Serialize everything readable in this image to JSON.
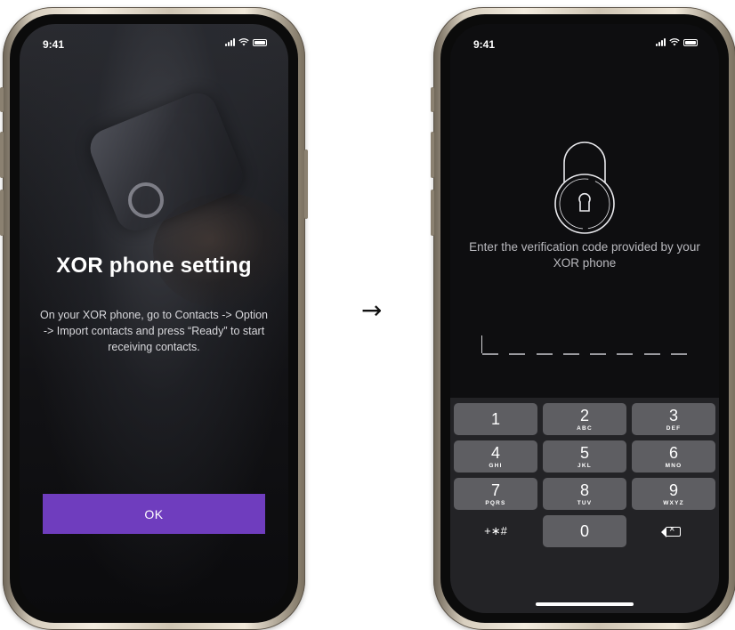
{
  "left_screen": {
    "status_time": "9:41",
    "title": "XOR phone setting",
    "body": "On your XOR phone, go to Contacts -> Option -> Import contacts and press “Ready” to start receiving contacts.",
    "ok_label": "OK"
  },
  "transition": {
    "arrow": "→"
  },
  "right_screen": {
    "status_time": "9:41",
    "prompt": "Enter the verification code provided by your XOR phone",
    "code_length": 8,
    "keypad": [
      {
        "num": "1",
        "letters": ""
      },
      {
        "num": "2",
        "letters": "ABC"
      },
      {
        "num": "3",
        "letters": "DEF"
      },
      {
        "num": "4",
        "letters": "GHI"
      },
      {
        "num": "5",
        "letters": "JKL"
      },
      {
        "num": "6",
        "letters": "MNO"
      },
      {
        "num": "7",
        "letters": "PQRS"
      },
      {
        "num": "8",
        "letters": "TUV"
      },
      {
        "num": "9",
        "letters": "WXYZ"
      }
    ],
    "symbols_label": "+∗#",
    "zero_label": "0",
    "delete_icon": "backspace-icon"
  },
  "colors": {
    "accent": "#6f3dbe",
    "key": "#5e5e62",
    "keypad_bg": "#232326"
  }
}
